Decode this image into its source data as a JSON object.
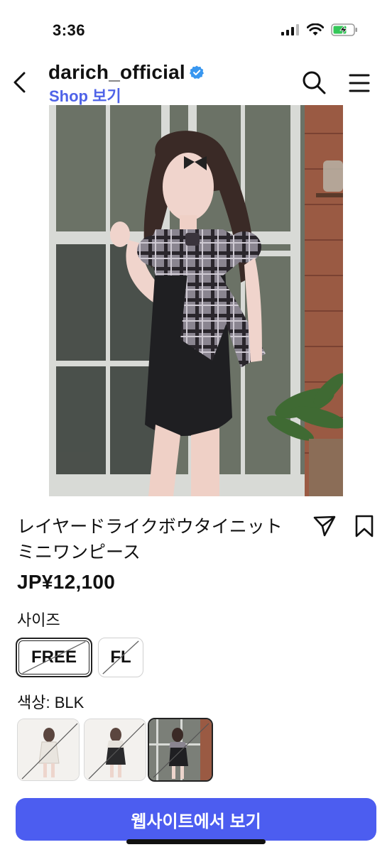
{
  "status_bar": {
    "time": "3:36"
  },
  "header": {
    "account_name": "darich_official",
    "shop_link": "Shop 보기",
    "icons": [
      "back-icon",
      "verified-badge-icon",
      "search-icon",
      "menu-icon"
    ]
  },
  "product": {
    "title": "レイヤードライクボウタイニットミニワンピース",
    "price": "JP¥12,100",
    "size_label": "사이즈",
    "sizes": [
      {
        "label": "FREE",
        "selected": true,
        "unavailable": true
      },
      {
        "label": "FL",
        "selected": false,
        "unavailable": true
      }
    ],
    "color_label": "색상: BLK",
    "color_swatches": [
      {
        "name": "white",
        "selected": false,
        "unavailable": true
      },
      {
        "name": "black",
        "selected": false,
        "unavailable": true
      },
      {
        "name": "BLK",
        "selected": true,
        "unavailable": true
      }
    ],
    "cta_label": "웹사이트에서 보기"
  },
  "colors": {
    "accent": "#4c5df0",
    "shop_link": "#4f63e8",
    "verified": "#3897f0"
  }
}
